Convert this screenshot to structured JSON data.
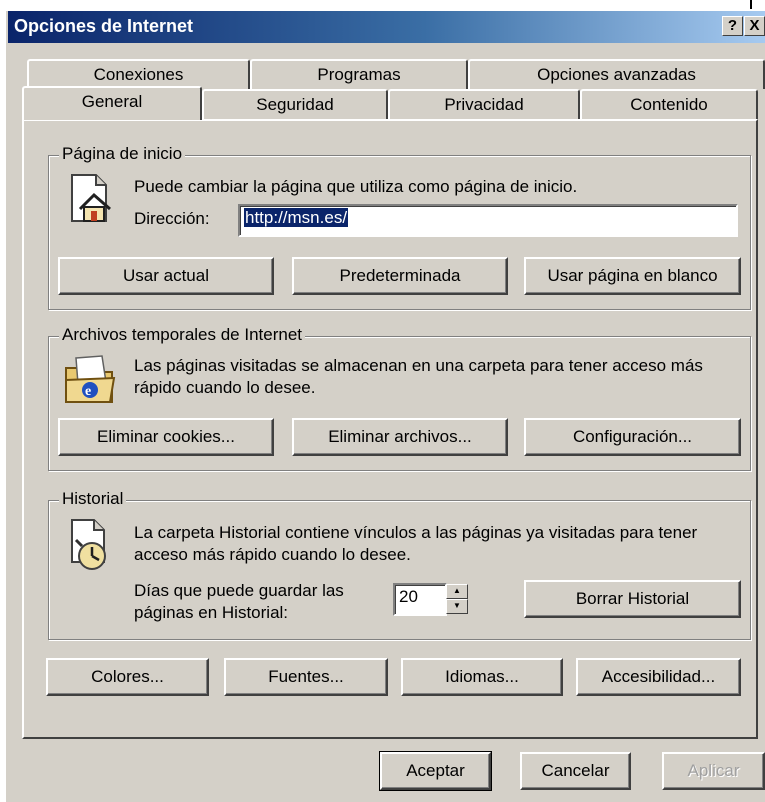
{
  "window": {
    "title": "Opciones de Internet",
    "help_button": "?",
    "close_button": "X"
  },
  "tabs_row1": [
    {
      "label": "Conexiones"
    },
    {
      "label": "Programas"
    },
    {
      "label": "Opciones avanzadas"
    }
  ],
  "tabs_row2": [
    {
      "label": "General",
      "active": true
    },
    {
      "label": "Seguridad"
    },
    {
      "label": "Privacidad"
    },
    {
      "label": "Contenido"
    }
  ],
  "home_page": {
    "legend": "Página de inicio",
    "description": "Puede cambiar la página que utiliza como página de inicio.",
    "address_label": "Dirección:",
    "address_value": "http://msn.es/",
    "btn_current": "Usar actual",
    "btn_default": "Predeterminada",
    "btn_blank": "Usar página en blanco"
  },
  "temp_files": {
    "legend": "Archivos temporales de Internet",
    "description_line1": "Las páginas visitadas se almacenan en una carpeta para tener acceso más",
    "description_line2": "rápido cuando lo desee.",
    "btn_cookies": "Eliminar cookies...",
    "btn_files": "Eliminar archivos...",
    "btn_settings": "Configuración..."
  },
  "history": {
    "legend": "Historial",
    "description_line1": "La carpeta Historial contiene vínculos a las páginas ya visitadas para tener",
    "description_line2": "acceso más rápido cuando lo desee.",
    "days_label_line1": "Días que puede guardar las",
    "days_label_line2": "páginas en Historial:",
    "days_value": "20",
    "btn_clear": "Borrar Historial"
  },
  "bottom_buttons": {
    "colors": "Colores...",
    "fonts": "Fuentes...",
    "languages": "Idiomas...",
    "accessibility": "Accesibilidad..."
  },
  "dialog_buttons": {
    "ok": "Aceptar",
    "cancel": "Cancelar",
    "apply": "Aplicar"
  },
  "colors": {
    "titlebar_start": "#0a246a",
    "titlebar_end": "#a6caf0",
    "face": "#d4d0c8",
    "selection": "#0a246a"
  }
}
